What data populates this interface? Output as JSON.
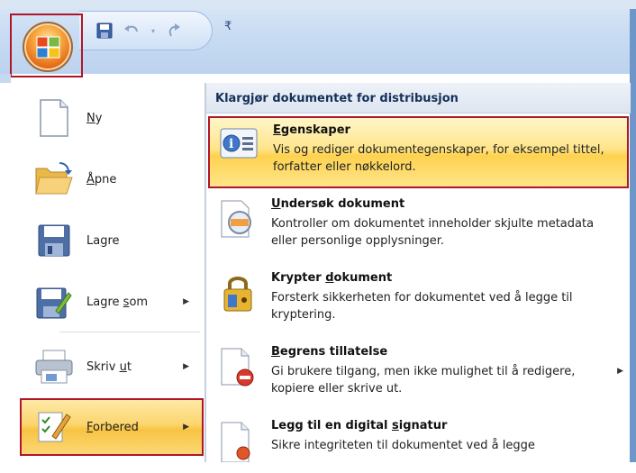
{
  "quick_access": {
    "save_icon": "save-icon",
    "undo_icon": "undo-icon",
    "redo_icon": "redo-icon",
    "more_glyph": "₹"
  },
  "office_button": {
    "icon": "office-logo-icon"
  },
  "left_menu": {
    "items": [
      {
        "label_pre": "",
        "label_key": "N",
        "label_post": "y",
        "icon": "new-document-icon",
        "has_arrow": false
      },
      {
        "label_pre": "",
        "label_key": "Å",
        "label_post": "pne",
        "icon": "open-folder-icon",
        "has_arrow": false
      },
      {
        "label_pre": "La",
        "label_key": "g",
        "label_post": "re",
        "icon": "save-disk-icon",
        "has_arrow": false
      },
      {
        "label_pre": "Lagre ",
        "label_key": "s",
        "label_post": "om",
        "icon": "save-as-icon",
        "has_arrow": true
      },
      {
        "label_pre": "Skriv ",
        "label_key": "u",
        "label_post": "t",
        "icon": "printer-icon",
        "has_arrow": true
      },
      {
        "label_pre": "",
        "label_key": "F",
        "label_post": "orbered",
        "icon": "prepare-document-icon",
        "has_arrow": true
      }
    ],
    "arrow": "▶"
  },
  "right_panel": {
    "header": "Klargjør dokumentet for distribusjon",
    "items": [
      {
        "title_pre": "",
        "title_key": "E",
        "title_post": "genskaper",
        "desc": "Vis og rediger dokumentegenskaper, for eksempel tittel, forfatter eller nøkkelord.",
        "icon": "properties-icon"
      },
      {
        "title_pre": "",
        "title_key": "U",
        "title_post": "ndersøk dokument",
        "desc": "Kontroller om dokumentet inneholder skjulte metadata eller personlige opplysninger.",
        "icon": "inspect-document-icon"
      },
      {
        "title_pre": "Krypter ",
        "title_key": "d",
        "title_post": "okument",
        "desc": "Forsterk sikkerheten for dokumentet ved å legge til kryptering.",
        "icon": "encrypt-lock-icon"
      },
      {
        "title_pre": "",
        "title_key": "B",
        "title_post": "egrens tillatelse",
        "desc": "Gi brukere tilgang, men ikke mulighet til å redigere, kopiere eller skrive ut.",
        "icon": "restrict-permission-icon"
      },
      {
        "title_pre": "Legg til en digital ",
        "title_key": "s",
        "title_post": "ignatur",
        "desc": "Sikre integriteten til dokumentet ved å legge",
        "icon": "digital-signature-icon"
      }
    ],
    "arrow": "▶"
  },
  "colors": {
    "highlight_border": "#b0162a",
    "hover_gold": "#fcd56e",
    "ribbon_blue": "#c9dcf3"
  }
}
